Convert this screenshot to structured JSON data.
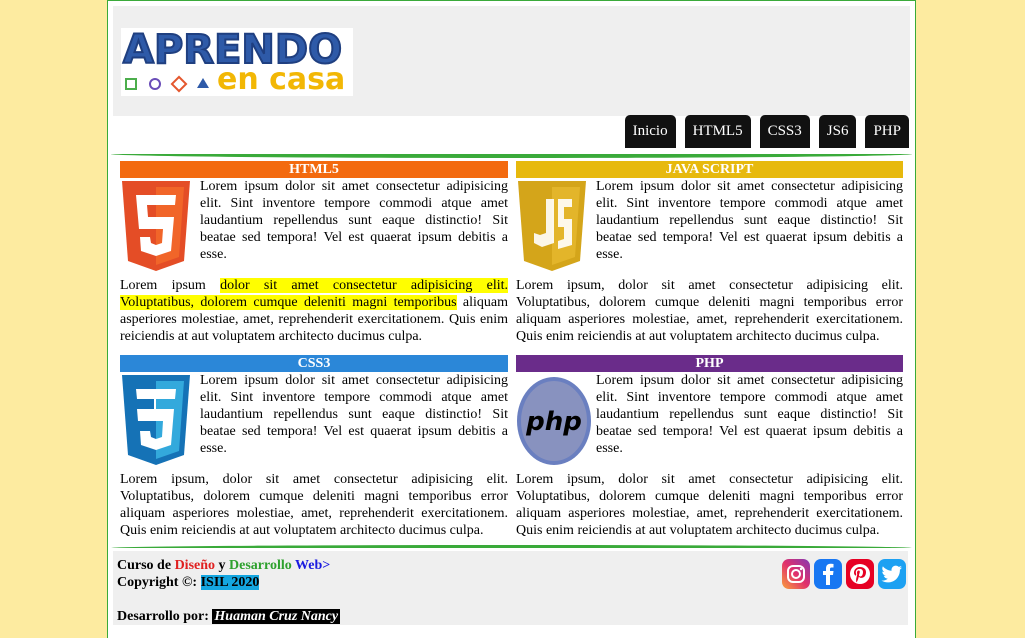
{
  "brand": {
    "line1": "APRENDO",
    "line2": "en casa"
  },
  "nav": [
    "Inicio",
    "HTML5",
    "CSS3",
    "JS6",
    "PHP"
  ],
  "sections": [
    {
      "title": "HTML5",
      "color": "#f36a0f",
      "p1": "Lorem ipsum dolor sit amet consectetur adipisicing elit. Sint inventore tempore commodi atque amet laudantium repellendus sunt eaque distinctio! Sit beatae sed tempora! Vel est quaerat ipsum debitis a esse.",
      "p2_pre": "Lorem ipsum ",
      "p2_hl": "dolor sit amet consectetur adipisicing elit. Voluptatibus, dolorem cumque deleniti magni temporibus",
      "p2_post": " aliquam asperiores molestiae, amet, reprehenderit exercitationem. Quis enim reiciendis at aut voluptatem architecto ducimus culpa."
    },
    {
      "title": "JAVA SCRIPT",
      "color": "#e7b90d",
      "p1": "Lorem ipsum dolor sit amet consectetur adipisicing elit. Sint inventore tempore commodi atque amet laudantium repellendus sunt eaque distinctio! Sit beatae sed tempora! Vel est quaerat ipsum debitis a esse.",
      "p2": "Lorem ipsum, dolor sit amet consectetur adipisicing elit. Voluptatibus, dolorem cumque deleniti magni temporibus error aliquam asperiores molestiae, amet, reprehenderit exercitationem. Quis enim reiciendis at aut voluptatem architecto ducimus culpa."
    },
    {
      "title": "CSS3",
      "color": "#2b87d8",
      "p1": "Lorem ipsum dolor sit amet consectetur adipisicing elit. Sint inventore tempore commodi atque amet laudantium repellendus sunt eaque distinctio! Sit beatae sed tempora! Vel est quaerat ipsum debitis a esse.",
      "p2": "Lorem ipsum, dolor sit amet consectetur adipisicing elit. Voluptatibus, dolorem cumque deleniti magni temporibus error aliquam asperiores molestiae, amet, reprehenderit exercitationem. Quis enim reiciendis at aut voluptatem architecto ducimus culpa."
    },
    {
      "title": "PHP",
      "color": "#6a2c8a",
      "p1": "Lorem ipsum dolor sit amet consectetur adipisicing elit. Sint inventore tempore commodi atque amet laudantium repellendus sunt eaque distinctio! Sit beatae sed tempora! Vel est quaerat ipsum debitis a esse.",
      "p2": "Lorem ipsum, dolor sit amet consectetur adipisicing elit. Voluptatibus, dolorem cumque deleniti magni temporibus error aliquam asperiores molestiae, amet, reprehenderit exercitationem. Quis enim reiciendis at aut voluptatem architecto ducimus culpa."
    }
  ],
  "footer": {
    "curso": "Curso de ",
    "diseno": "Diseño",
    "y": " y ",
    "desarrollo": "Desarrollo",
    "web": " Web>",
    "copyright": "Copyright ©: ",
    "isil": "ISIL 2020",
    "dev_by": "Desarrollo por: ",
    "author": "Huaman Cruz Nancy"
  },
  "social_icons": [
    "instagram-icon",
    "facebook-icon",
    "pinterest-icon",
    "twitter-icon"
  ]
}
